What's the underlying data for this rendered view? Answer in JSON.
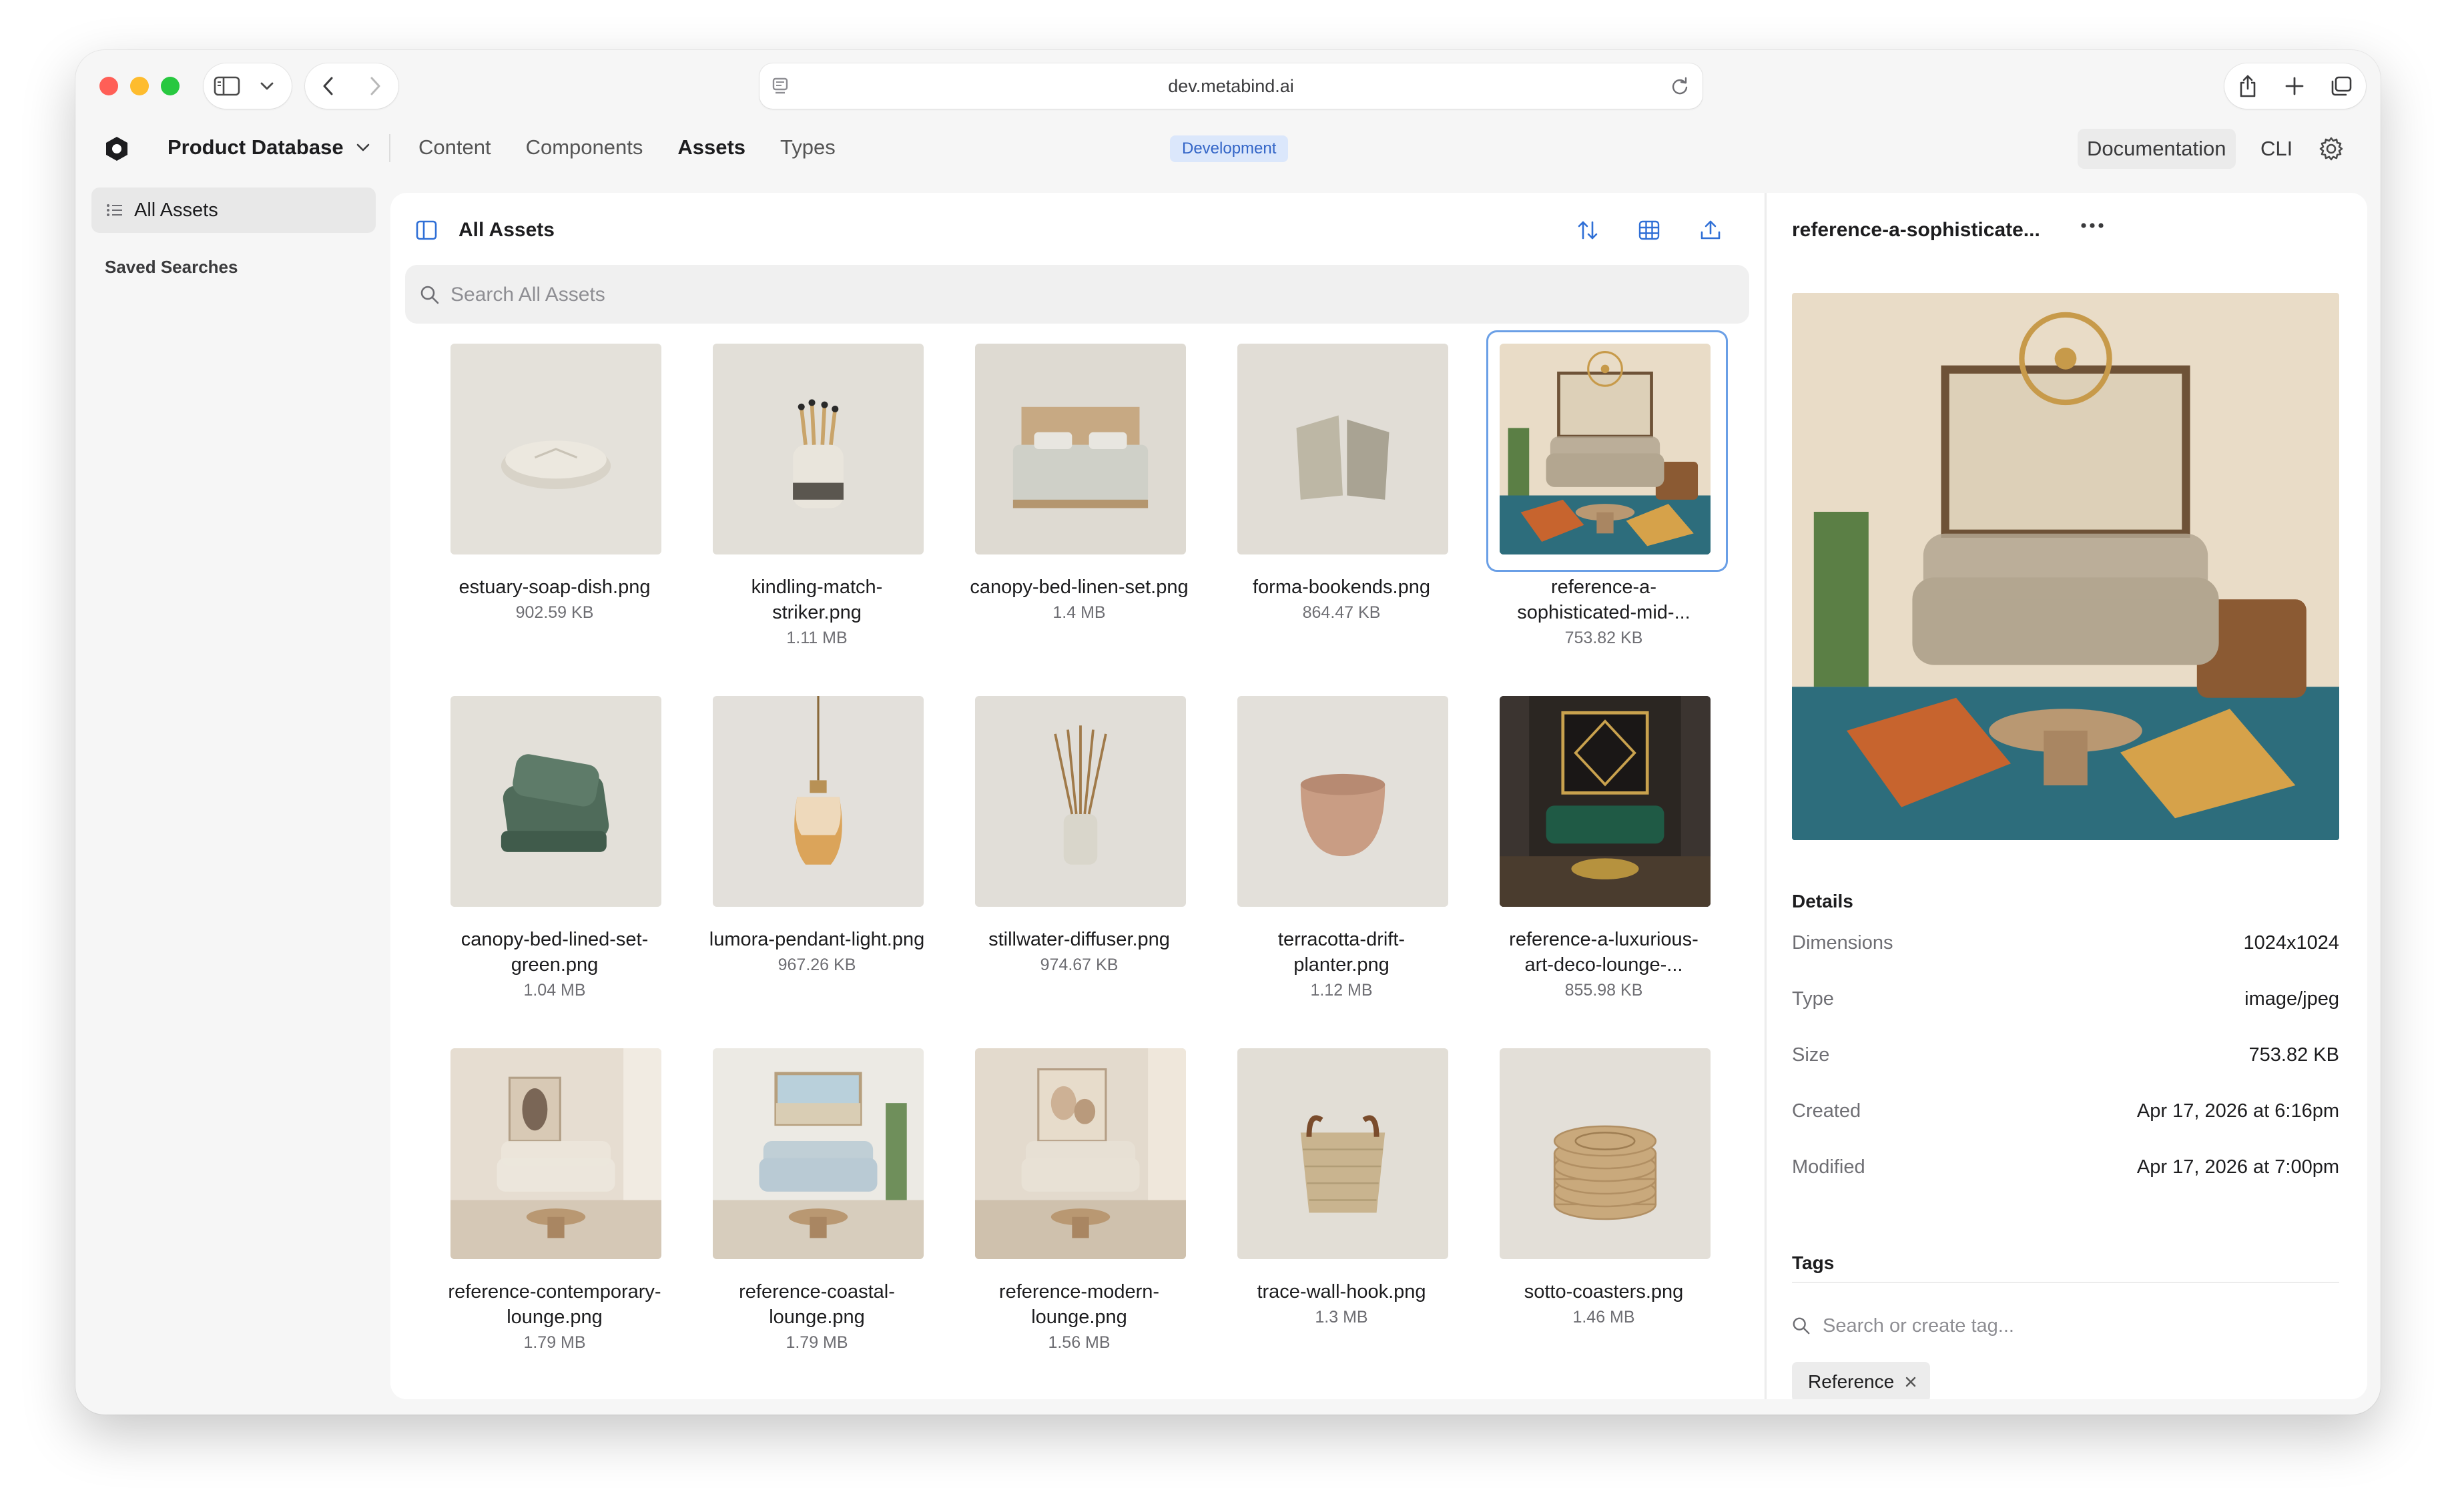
{
  "browser": {
    "url": "dev.metabind.ai"
  },
  "app": {
    "database_name": "Product Database",
    "nav": [
      "Content",
      "Components",
      "Assets",
      "Types"
    ],
    "environment": "Development",
    "documentation_label": "Documentation",
    "cli_label": "CLI"
  },
  "sidebar": {
    "all_assets": "All Assets",
    "saved_searches": "Saved Searches"
  },
  "center": {
    "title": "All Assets",
    "search_placeholder": "Search All Assets"
  },
  "assets": [
    {
      "name_lines": [
        "estuary-soap-dish.png"
      ],
      "size": "902.59 KB",
      "art": "soap"
    },
    {
      "name_lines": [
        "kindling-match-",
        "striker.png"
      ],
      "size": "1.11 MB",
      "art": "match"
    },
    {
      "name_lines": [
        "canopy-bed-linen-set.png"
      ],
      "size": "1.4 MB",
      "art": "bed"
    },
    {
      "name_lines": [
        "forma-bookends.png"
      ],
      "size": "864.47 KB",
      "art": "bookends"
    },
    {
      "name_lines": [
        "reference-a-",
        "sophisticated-mid-..."
      ],
      "size": "753.82 KB",
      "art": "midcentury",
      "selected": true
    },
    {
      "name_lines": [
        "canopy-bed-lined-set-",
        "green.png"
      ],
      "size": "1.04 MB",
      "art": "pillows"
    },
    {
      "name_lines": [
        "lumora-pendant-light.png"
      ],
      "size": "967.26 KB",
      "art": "pendant"
    },
    {
      "name_lines": [
        "stillwater-diffuser.png"
      ],
      "size": "974.67 KB",
      "art": "diffuser"
    },
    {
      "name_lines": [
        "terracotta-drift-",
        "planter.png"
      ],
      "size": "1.12 MB",
      "art": "planter"
    },
    {
      "name_lines": [
        "reference-a-luxurious-",
        "art-deco-lounge-..."
      ],
      "size": "855.98 KB",
      "art": "artdeco"
    },
    {
      "name_lines": [
        "reference-contemporary-",
        "lounge.png"
      ],
      "size": "1.79 MB",
      "art": "contemporary"
    },
    {
      "name_lines": [
        "reference-coastal-",
        "lounge.png"
      ],
      "size": "1.79 MB",
      "art": "coastal"
    },
    {
      "name_lines": [
        "reference-modern-",
        "lounge.png"
      ],
      "size": "1.56 MB",
      "art": "modern"
    },
    {
      "name_lines": [
        "trace-wall-hook.png"
      ],
      "size": "1.3 MB",
      "art": "basket"
    },
    {
      "name_lines": [
        "sotto-coasters.png"
      ],
      "size": "1.46 MB",
      "art": "coasters"
    }
  ],
  "detail": {
    "title": "reference-a-sophisticate...",
    "details_heading": "Details",
    "rows": [
      {
        "key": "Dimensions",
        "value": "1024x1024"
      },
      {
        "key": "Type",
        "value": "image/jpeg"
      },
      {
        "key": "Size",
        "value": "753.82 KB"
      },
      {
        "key": "Created",
        "value": "Apr 17, 2026 at 6:16pm"
      },
      {
        "key": "Modified",
        "value": "Apr 17, 2026 at 7:00pm"
      }
    ],
    "tags_heading": "Tags",
    "tag_search_placeholder": "Search or create tag...",
    "tags": [
      "Reference"
    ]
  },
  "colors": {
    "accent": "#2f6fd6",
    "selection": "#6a9fe6",
    "env_badge_bg": "#dbe7fb"
  },
  "icons": [
    "sidebar-toggle-icon",
    "chevron-down-icon",
    "back-icon",
    "forward-icon",
    "page-icon",
    "reload-icon",
    "share-icon",
    "new-tab-icon",
    "tabs-icon",
    "logo-icon",
    "gear-icon",
    "list-icon",
    "panel-icon",
    "sort-icon",
    "grid-view-icon",
    "upload-icon",
    "search-icon",
    "more-icon",
    "close-icon"
  ]
}
